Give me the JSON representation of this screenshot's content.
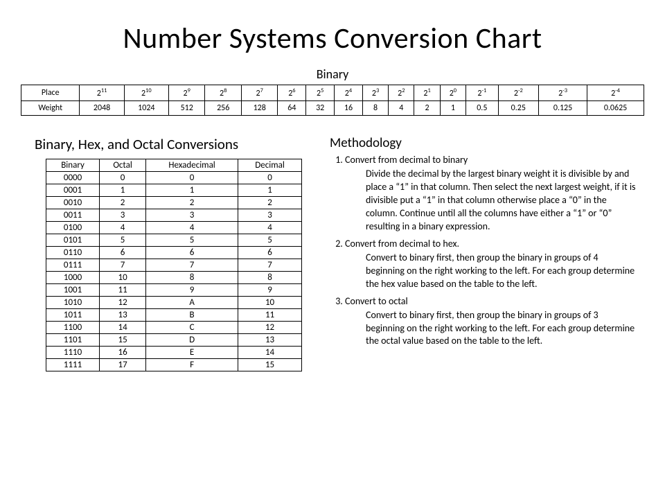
{
  "title": "Number Systems Conversion Chart",
  "binary_label": "Binary",
  "place_weight": {
    "row_labels": {
      "place": "Place",
      "weight": "Weight"
    },
    "places_base": [
      "2",
      "2",
      "2",
      "2",
      "2",
      "2",
      "2",
      "2",
      "2",
      "2",
      "2",
      "2",
      "2",
      "2",
      "2",
      "2"
    ],
    "places_exp": [
      "11",
      "10",
      "9",
      "8",
      "7",
      "6",
      "5",
      "4",
      "3",
      "2",
      "1",
      "0",
      "-1",
      "-2",
      "-3",
      "-4"
    ],
    "weights": [
      "2048",
      "1024",
      "512",
      "256",
      "128",
      "64",
      "32",
      "16",
      "8",
      "4",
      "2",
      "1",
      "0.5",
      "0.25",
      "0.125",
      "0.0625"
    ]
  },
  "conv_title": "Binary, Hex, and Octal Conversions",
  "conv_headers": [
    "Binary",
    "Octal",
    "Hexadecimal",
    "Decimal"
  ],
  "conv_rows": [
    [
      "0000",
      "0",
      "0",
      "0"
    ],
    [
      "0001",
      "1",
      "1",
      "1"
    ],
    [
      "0010",
      "2",
      "2",
      "2"
    ],
    [
      "0011",
      "3",
      "3",
      "3"
    ],
    [
      "0100",
      "4",
      "4",
      "4"
    ],
    [
      "0101",
      "5",
      "5",
      "5"
    ],
    [
      "0110",
      "6",
      "6",
      "6"
    ],
    [
      "0111",
      "7",
      "7",
      "7"
    ],
    [
      "1000",
      "10",
      "8",
      "8"
    ],
    [
      "1001",
      "11",
      "9",
      "9"
    ],
    [
      "1010",
      "12",
      "A",
      "10"
    ],
    [
      "1011",
      "13",
      "B",
      "11"
    ],
    [
      "1100",
      "14",
      "C",
      "12"
    ],
    [
      "1101",
      "15",
      "D",
      "13"
    ],
    [
      "1110",
      "16",
      "E",
      "14"
    ],
    [
      "1111",
      "17",
      "F",
      "15"
    ]
  ],
  "methodology": {
    "title": "Methodology",
    "items": [
      {
        "heading": "Convert from decimal to binary",
        "body": "Divide the decimal by the largest binary weight it is divisible by and place a “1” in that column. Then select the next largest weight, if it is divisible put a “1” in that column otherwise place a “0” in the column.  Continue until all the columns have either a “1” or “0” resulting in a binary expression."
      },
      {
        "heading": "Convert from decimal to hex.",
        "body": "Convert to binary first, then group the binary in groups of 4 beginning on the right working to the left.  For each group determine the hex value based on the table to the left."
      },
      {
        "heading": "Convert to octal",
        "body": "Convert to binary first, then group the binary in groups of 3 beginning on the right working to the left.  For each group determine the octal value based on the table to the left."
      }
    ]
  }
}
